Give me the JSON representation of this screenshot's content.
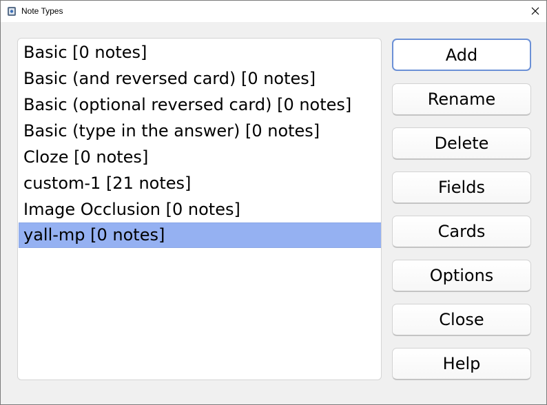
{
  "window": {
    "title": "Note Types"
  },
  "list": {
    "items": [
      "Basic [0 notes]",
      "Basic (and reversed card) [0 notes]",
      "Basic (optional reversed card) [0 notes]",
      "Basic (type in the answer) [0 notes]",
      "Cloze [0 notes]",
      "custom-1 [21 notes]",
      "Image Occlusion [0 notes]",
      "yall-mp [0 notes]"
    ],
    "selected_index": 7
  },
  "buttons": {
    "add": "Add",
    "rename": "Rename",
    "delete": "Delete",
    "fields": "Fields",
    "cards": "Cards",
    "options": "Options",
    "close": "Close",
    "help": "Help"
  },
  "colors": {
    "selection": "#95b1f2",
    "default_button_border": "#6b90d6"
  },
  "icons": {
    "app": "anki-app-icon",
    "close": "close-icon"
  }
}
